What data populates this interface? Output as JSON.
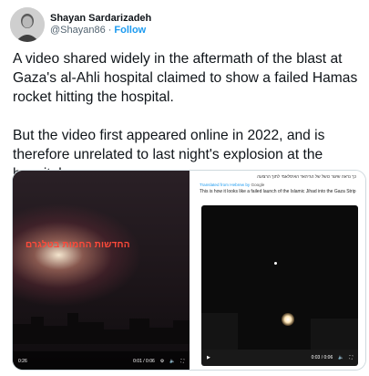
{
  "author": {
    "name": "Shayan Sardarizadeh",
    "handle": "@Shayan86",
    "separator": "·",
    "follow_label": "Follow"
  },
  "tweet": {
    "paragraph1": "A video shared widely in the aftermath of the blast at Gaza's al-Ahli hospital claimed to show a failed Hamas rocket hitting the hospital.",
    "paragraph2": "But the video first appeared online in 2022, and is therefore unrelated to last night's explosion at the hospital."
  },
  "media": {
    "left_video": {
      "overlay_text": "החדשות החמות בטלגרם",
      "time_left": "0:26",
      "time": "0:01 / 0:06"
    },
    "right_video": {
      "original_text": "כך נראה שיגור כושל של הג'יהאד האיסלאמי לתוך הרצועה",
      "translated_from": "Translated from Hebrew by",
      "translator": "Google",
      "translated_text": "This is how it looks like a failed launch of the Islamic Jihad into the Gaza Strip",
      "time": "0:03 / 0:06"
    }
  }
}
